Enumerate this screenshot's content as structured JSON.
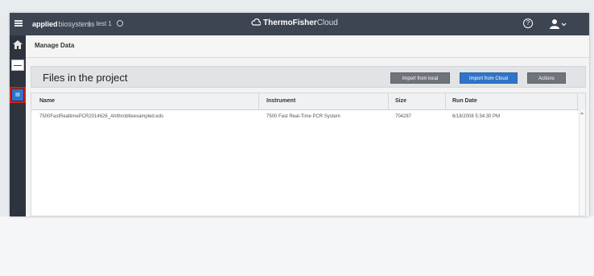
{
  "topbar": {
    "brand_bold": "applied",
    "brand_light": "biosystems",
    "breadcrumb_sep": "|",
    "breadcrumb_text": "test 1",
    "center_logo_bold": "ThermoFisher",
    "center_logo_light": "Cloud"
  },
  "page": {
    "title": "Manage Data"
  },
  "files_panel": {
    "title": "Files in the project",
    "buttons": {
      "import_local": "Import from local",
      "import_cloud": "Import from Cloud",
      "actions": "Actions"
    }
  },
  "table": {
    "columns": [
      "Name",
      "Instrument",
      "Size",
      "Run Date"
    ],
    "rows": [
      {
        "name": "7500FastRealtimePCR2014626_Ahlthrobtleexampled.eds",
        "instrument": "7500 Fast Real-Time PCR System",
        "size": "704287",
        "run_date": "6/18/2008 5:34:30 PM"
      }
    ]
  },
  "colors": {
    "topbar": "#3d4553",
    "sidebar": "#2e343e",
    "primary_button": "#2f74c9",
    "secondary_button": "#6f747a",
    "selection_outline": "#d21e1e"
  }
}
